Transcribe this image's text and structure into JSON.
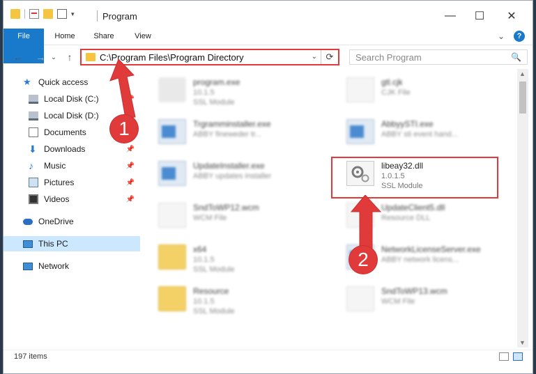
{
  "window": {
    "title": "Program",
    "controls": {
      "minimize": "—",
      "maximize": "☐",
      "close": "✕"
    }
  },
  "ribbon": {
    "tabs": [
      "File",
      "Home",
      "Share",
      "View"
    ],
    "expand": "⌄",
    "help": "?"
  },
  "address_bar": {
    "back": "←",
    "forward": "→",
    "recent": "⌄",
    "up": "↑",
    "path": "C:\\Program Files\\Program Directory",
    "dropdown": "⌄",
    "refresh": "⟳",
    "search_placeholder": "Search Program",
    "search_icon": "🔍"
  },
  "nav": {
    "items": [
      {
        "label": "Quick access",
        "icon": "star-icon",
        "pin": ""
      },
      {
        "label": "Local Disk (C:)",
        "icon": "drive-icon",
        "pin": "📌"
      },
      {
        "label": "Local Disk (D:)",
        "icon": "drive-icon",
        "pin": "📌"
      },
      {
        "label": "Documents",
        "icon": "document-icon",
        "pin": "📌"
      },
      {
        "label": "Downloads",
        "icon": "download-icon",
        "pin": "📌"
      },
      {
        "label": "Music",
        "icon": "music-icon",
        "pin": "📌"
      },
      {
        "label": "Pictures",
        "icon": "picture-icon",
        "pin": "📌"
      },
      {
        "label": "Videos",
        "icon": "video-icon",
        "pin": "📌"
      },
      {
        "label": "OneDrive",
        "icon": "cloud-icon",
        "pin": ""
      },
      {
        "label": "This PC",
        "icon": "pc-icon",
        "pin": ""
      },
      {
        "label": "Network",
        "icon": "network-icon",
        "pin": ""
      }
    ]
  },
  "files": [
    {
      "name": "program.exe",
      "line1": "10.1.5",
      "line2": "SSL Module",
      "type": "app"
    },
    {
      "name": "gtl.cjk",
      "line1": "CJK File",
      "line2": "",
      "type": "doc"
    },
    {
      "name": "Trgramminstaller.exe",
      "line1": "ABBY fineweder tr...",
      "line2": "",
      "type": "app"
    },
    {
      "name": "AbbyySTI.exe",
      "line1": "ABBY sti event hand...",
      "line2": "",
      "type": "app"
    },
    {
      "name": "UpdateInstaller.exe",
      "line1": "ABBY updates installer",
      "line2": "",
      "type": "app"
    },
    {
      "name": "libeay32.dll",
      "line1": "1.0.1.5",
      "line2": "SSL Module",
      "type": "dll"
    },
    {
      "name": "SndToWP12.wcm",
      "line1": "WCM File",
      "line2": "",
      "type": "doc"
    },
    {
      "name": "UpdateClient5.dll",
      "line1": "Resource DLL",
      "line2": "",
      "type": "dll"
    },
    {
      "name": "x64",
      "line1": "10.1.5",
      "line2": "SSL Module",
      "type": "folder"
    },
    {
      "name": "NetworkLicenseServer.exe",
      "line1": "ABBY network licens...",
      "line2": "",
      "type": "app"
    },
    {
      "name": "Resource",
      "line1": "10.1.5",
      "line2": "SSL Module",
      "type": "folder"
    },
    {
      "name": "SndToWP13.wcm",
      "line1": "WCM File",
      "line2": "",
      "type": "doc"
    }
  ],
  "status": {
    "count": "197 items"
  },
  "annotations": {
    "badge1": "1",
    "badge2": "2",
    "arrow_color": "#e03a3a"
  }
}
